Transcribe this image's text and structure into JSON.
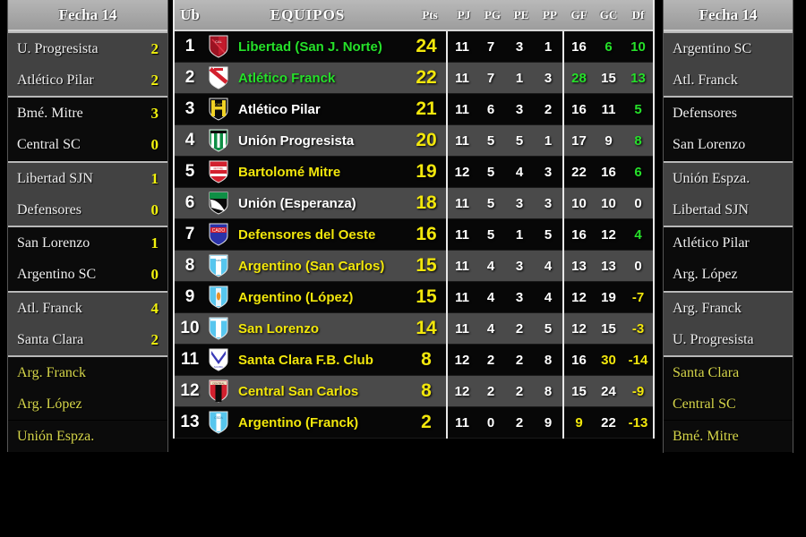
{
  "colors": {
    "accent_yellow": "#f2e70c",
    "accent_green": "#26e02a",
    "panel_grey": "#4a4a4a",
    "panel_black": "#070707",
    "header_grey": "#b0b0b0"
  },
  "left_panel": {
    "title": "Fecha 14",
    "matches": [
      {
        "home": "U. Progresista",
        "home_score": "2",
        "away": "Atlético Pilar",
        "away_score": "2",
        "shaded": true
      },
      {
        "home": "Bmé. Mitre",
        "home_score": "3",
        "away": "Central SC",
        "away_score": "0",
        "shaded": false
      },
      {
        "home": "Libertad SJN",
        "home_score": "1",
        "away": "Defensores",
        "away_score": "0",
        "shaded": true
      },
      {
        "home": "San Lorenzo",
        "home_score": "1",
        "away": "Argentino SC",
        "away_score": "0",
        "shaded": false
      },
      {
        "home": "Atl. Franck",
        "home_score": "4",
        "away": "Santa Clara",
        "away_score": "2",
        "shaded": true
      },
      {
        "home": "Arg. Franck",
        "home_score": "",
        "away": "Arg. López",
        "away_score": "",
        "shaded": false,
        "pending": true
      }
    ],
    "extra": [
      {
        "name": "Unión Espza.",
        "pending": true
      }
    ]
  },
  "right_panel": {
    "title": "Fecha 14",
    "teams": [
      {
        "name": "Argentino SC",
        "shaded": true,
        "pending": false
      },
      {
        "name": "Atl. Franck",
        "shaded": true,
        "pending": false
      },
      {
        "name": "Defensores",
        "shaded": false,
        "pending": false
      },
      {
        "name": "San Lorenzo",
        "shaded": false,
        "pending": false
      },
      {
        "name": "Unión Espza.",
        "shaded": true,
        "pending": false
      },
      {
        "name": "Libertad SJN",
        "shaded": true,
        "pending": false
      },
      {
        "name": "Atlético Pilar",
        "shaded": false,
        "pending": false
      },
      {
        "name": "Arg. López",
        "shaded": false,
        "pending": false
      },
      {
        "name": "Arg. Franck",
        "shaded": true,
        "pending": false
      },
      {
        "name": "U. Progresista",
        "shaded": true,
        "pending": false
      },
      {
        "name": "Santa Clara",
        "shaded": false,
        "pending": true
      },
      {
        "name": "Central SC",
        "shaded": false,
        "pending": true
      },
      {
        "name": "Bmé. Mitre",
        "shaded": false,
        "pending": true
      }
    ]
  },
  "standings": {
    "columns": {
      "ub": "Ub",
      "team": "EQUIPOS",
      "pts": "Pts",
      "pj": "PJ",
      "pg": "PG",
      "pe": "PE",
      "pp": "PP",
      "gf": "GF",
      "gc": "GC",
      "df": "Df"
    },
    "rows": [
      {
        "ub": "1",
        "team": "Libertad (San J. Norte)",
        "team_color": "green",
        "pts": "24",
        "pj": "11",
        "pg": "7",
        "pe": "3",
        "pp": "1",
        "gf": "16",
        "gf_color": "white",
        "gc": "6",
        "gc_color": "green",
        "df": "10",
        "df_color": "green",
        "crest": "crest-libertad"
      },
      {
        "ub": "2",
        "team": "Atlético Franck",
        "team_color": "green",
        "pts": "22",
        "pj": "11",
        "pg": "7",
        "pe": "1",
        "pp": "3",
        "gf": "28",
        "gf_color": "green",
        "gc": "15",
        "gc_color": "white",
        "df": "13",
        "df_color": "green",
        "crest": "crest-atl-franck"
      },
      {
        "ub": "3",
        "team": "Atlético Pilar",
        "team_color": "white",
        "pts": "21",
        "pj": "11",
        "pg": "6",
        "pe": "3",
        "pp": "2",
        "gf": "16",
        "gf_color": "white",
        "gc": "11",
        "gc_color": "white",
        "df": "5",
        "df_color": "green",
        "crest": "crest-atl-pilar"
      },
      {
        "ub": "4",
        "team": "Unión Progresista",
        "team_color": "white",
        "pts": "20",
        "pj": "11",
        "pg": "5",
        "pe": "5",
        "pp": "1",
        "gf": "17",
        "gf_color": "white",
        "gc": "9",
        "gc_color": "white",
        "df": "8",
        "df_color": "green",
        "crest": "crest-union-prog"
      },
      {
        "ub": "5",
        "team": "Bartolomé Mitre",
        "team_color": "yellow",
        "pts": "19",
        "pj": "12",
        "pg": "5",
        "pe": "4",
        "pp": "3",
        "gf": "22",
        "gf_color": "white",
        "gc": "16",
        "gc_color": "white",
        "df": "6",
        "df_color": "green",
        "crest": "crest-mitre"
      },
      {
        "ub": "6",
        "team": "Unión (Esperanza)",
        "team_color": "white",
        "pts": "18",
        "pj": "11",
        "pg": "5",
        "pe": "3",
        "pp": "3",
        "gf": "10",
        "gf_color": "white",
        "gc": "10",
        "gc_color": "white",
        "df": "0",
        "df_color": "white",
        "crest": "crest-union-esp"
      },
      {
        "ub": "7",
        "team": "Defensores del Oeste",
        "team_color": "yellow",
        "pts": "16",
        "pj": "11",
        "pg": "5",
        "pe": "1",
        "pp": "5",
        "gf": "16",
        "gf_color": "white",
        "gc": "12",
        "gc_color": "white",
        "df": "4",
        "df_color": "green",
        "crest": "crest-defensores"
      },
      {
        "ub": "8",
        "team": "Argentino (San Carlos)",
        "team_color": "yellow",
        "pts": "15",
        "pj": "11",
        "pg": "4",
        "pe": "3",
        "pp": "4",
        "gf": "13",
        "gf_color": "white",
        "gc": "13",
        "gc_color": "white",
        "df": "0",
        "df_color": "white",
        "crest": "crest-arg-sc"
      },
      {
        "ub": "9",
        "team": "Argentino (López)",
        "team_color": "yellow",
        "pts": "15",
        "pj": "11",
        "pg": "4",
        "pe": "3",
        "pp": "4",
        "gf": "12",
        "gf_color": "white",
        "gc": "19",
        "gc_color": "white",
        "df": "-7",
        "df_color": "yellow",
        "crest": "crest-arg-lopez"
      },
      {
        "ub": "10",
        "team": "San Lorenzo",
        "team_color": "yellow",
        "pts": "14",
        "pj": "11",
        "pg": "4",
        "pe": "2",
        "pp": "5",
        "gf": "12",
        "gf_color": "white",
        "gc": "15",
        "gc_color": "white",
        "df": "-3",
        "df_color": "yellow",
        "crest": "crest-san-lorenzo"
      },
      {
        "ub": "11",
        "team": "Santa Clara F.B. Club",
        "team_color": "yellow",
        "pts": "8",
        "pj": "12",
        "pg": "2",
        "pe": "2",
        "pp": "8",
        "gf": "16",
        "gf_color": "white",
        "gc": "30",
        "gc_color": "yellow",
        "df": "-14",
        "df_color": "yellow",
        "crest": "crest-santa-clara"
      },
      {
        "ub": "12",
        "team": "Central San Carlos",
        "team_color": "yellow",
        "pts": "8",
        "pj": "12",
        "pg": "2",
        "pe": "2",
        "pp": "8",
        "gf": "15",
        "gf_color": "white",
        "gc": "24",
        "gc_color": "white",
        "df": "-9",
        "df_color": "yellow",
        "crest": "crest-central-sc"
      },
      {
        "ub": "13",
        "team": "Argentino (Franck)",
        "team_color": "yellow",
        "pts": "2",
        "pj": "11",
        "pg": "0",
        "pe": "2",
        "pp": "9",
        "gf": "9",
        "gf_color": "yellow",
        "gc": "22",
        "gc_color": "white",
        "df": "-13",
        "df_color": "yellow",
        "crest": "crest-arg-franck"
      }
    ]
  }
}
